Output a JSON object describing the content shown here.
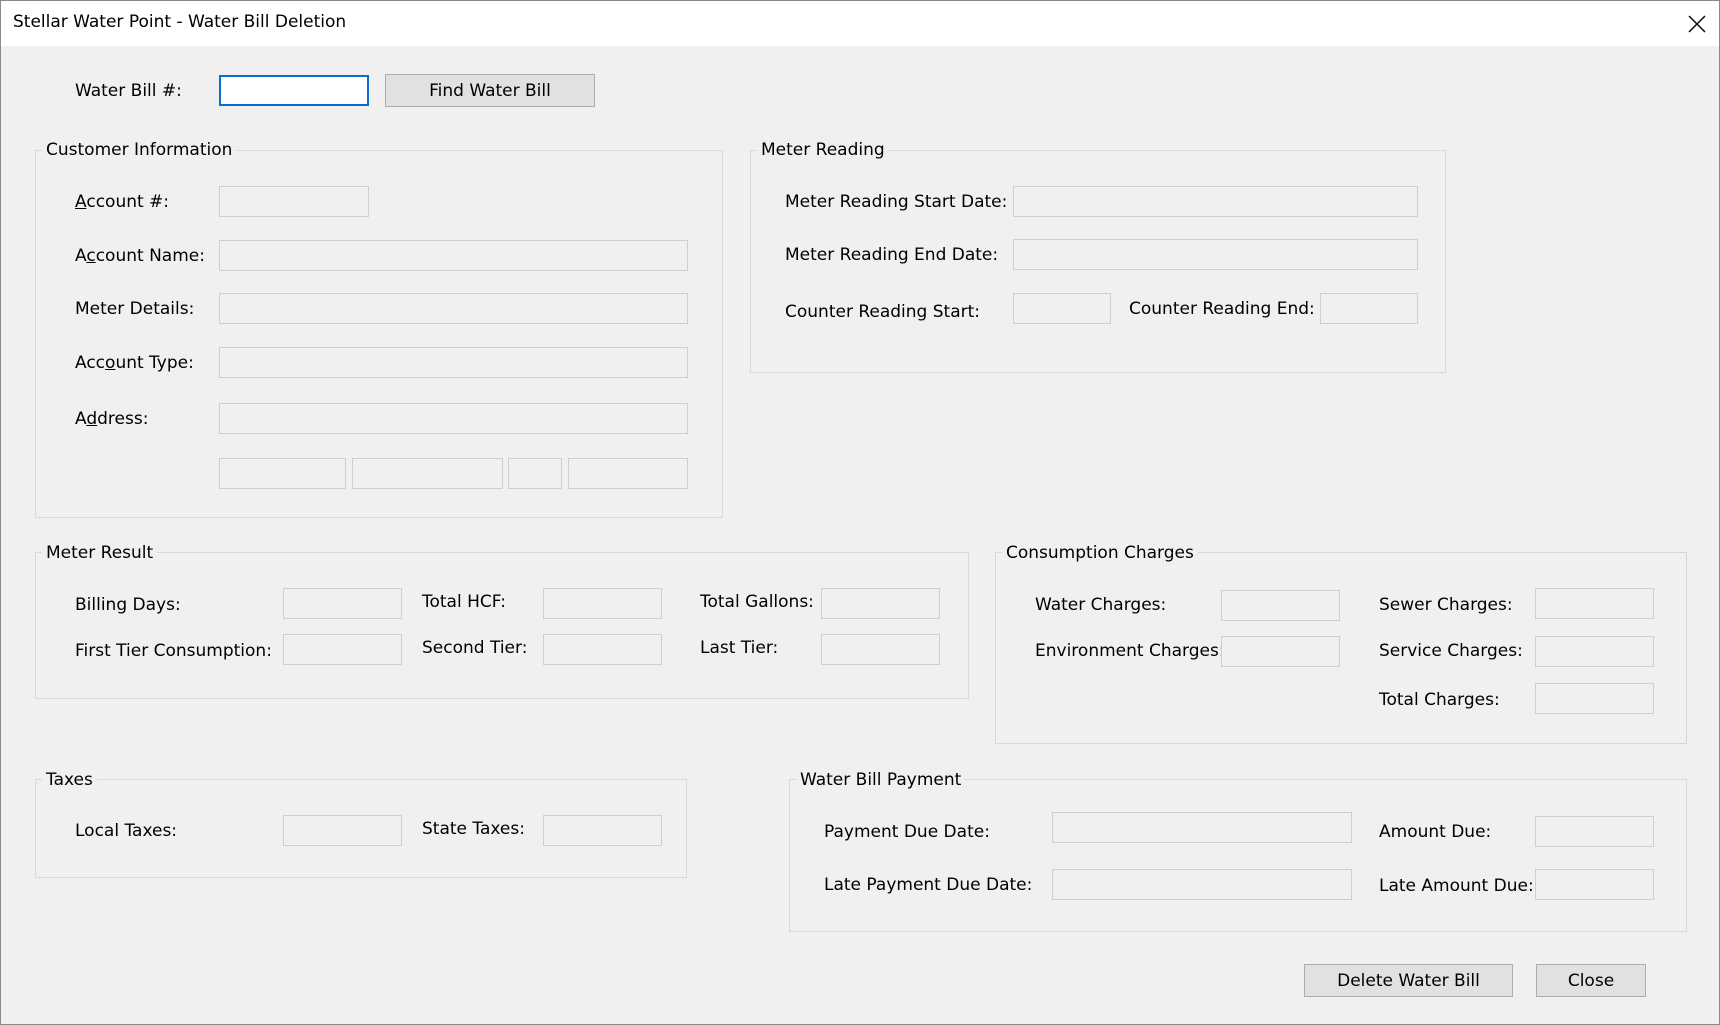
{
  "window": {
    "title": "Stellar Water Point - Water Bill Deletion"
  },
  "search": {
    "label": "Water Bill #:",
    "value": "",
    "find_button": "Find Water Bill"
  },
  "customer": {
    "legend": "Customer Information",
    "account_label_pre": "",
    "account_label_key": "A",
    "account_label_post": "ccount #:",
    "name_label_pre": "A",
    "name_label_key": "c",
    "name_label_post": "count Name:",
    "meter_label": "Meter Details:",
    "type_label_pre": "Acc",
    "type_label_key": "o",
    "type_label_post": "unt Type:",
    "address_label_pre": "A",
    "address_label_key": "d",
    "address_label_post": "dress:"
  },
  "meter_reading": {
    "legend": "Meter Reading",
    "start_date_label": "Meter Reading Start Date:",
    "end_date_label": "Meter Reading End Date:",
    "counter_start_label": "Counter Reading Start:",
    "counter_end_label": "Counter Reading End:"
  },
  "meter_result": {
    "legend": "Meter Result",
    "billing_days_label": "Billing Days:",
    "total_hcf_label": "Total HCF:",
    "total_gallons_label": "Total Gallons:",
    "first_tier_label": "First Tier Consumption:",
    "second_tier_label": "Second Tier:",
    "last_tier_label": "Last Tier:"
  },
  "consumption": {
    "legend": "Consumption Charges",
    "water_label": "Water Charges:",
    "sewer_label": "Sewer Charges:",
    "environment_label": "Environment Charges:",
    "service_label": "Service Charges:",
    "total_label": "Total Charges:"
  },
  "taxes": {
    "legend": "Taxes",
    "local_label": "Local Taxes:",
    "state_label": "State Taxes:"
  },
  "payment": {
    "legend": "Water Bill Payment",
    "due_date_label": "Payment Due Date:",
    "amount_due_label": "Amount Due:",
    "late_due_date_label": "Late Payment Due Date:",
    "late_amount_label": "Late Amount Due:"
  },
  "actions": {
    "delete_button": "Delete Water Bill",
    "close_button": "Close"
  },
  "icons": {
    "close": "close-icon"
  },
  "colors": {
    "window_bg": "#f0f0f0",
    "titlebar_bg": "#ffffff",
    "focus_border": "#0a6ed1",
    "button_bg": "#e1e1e1"
  }
}
